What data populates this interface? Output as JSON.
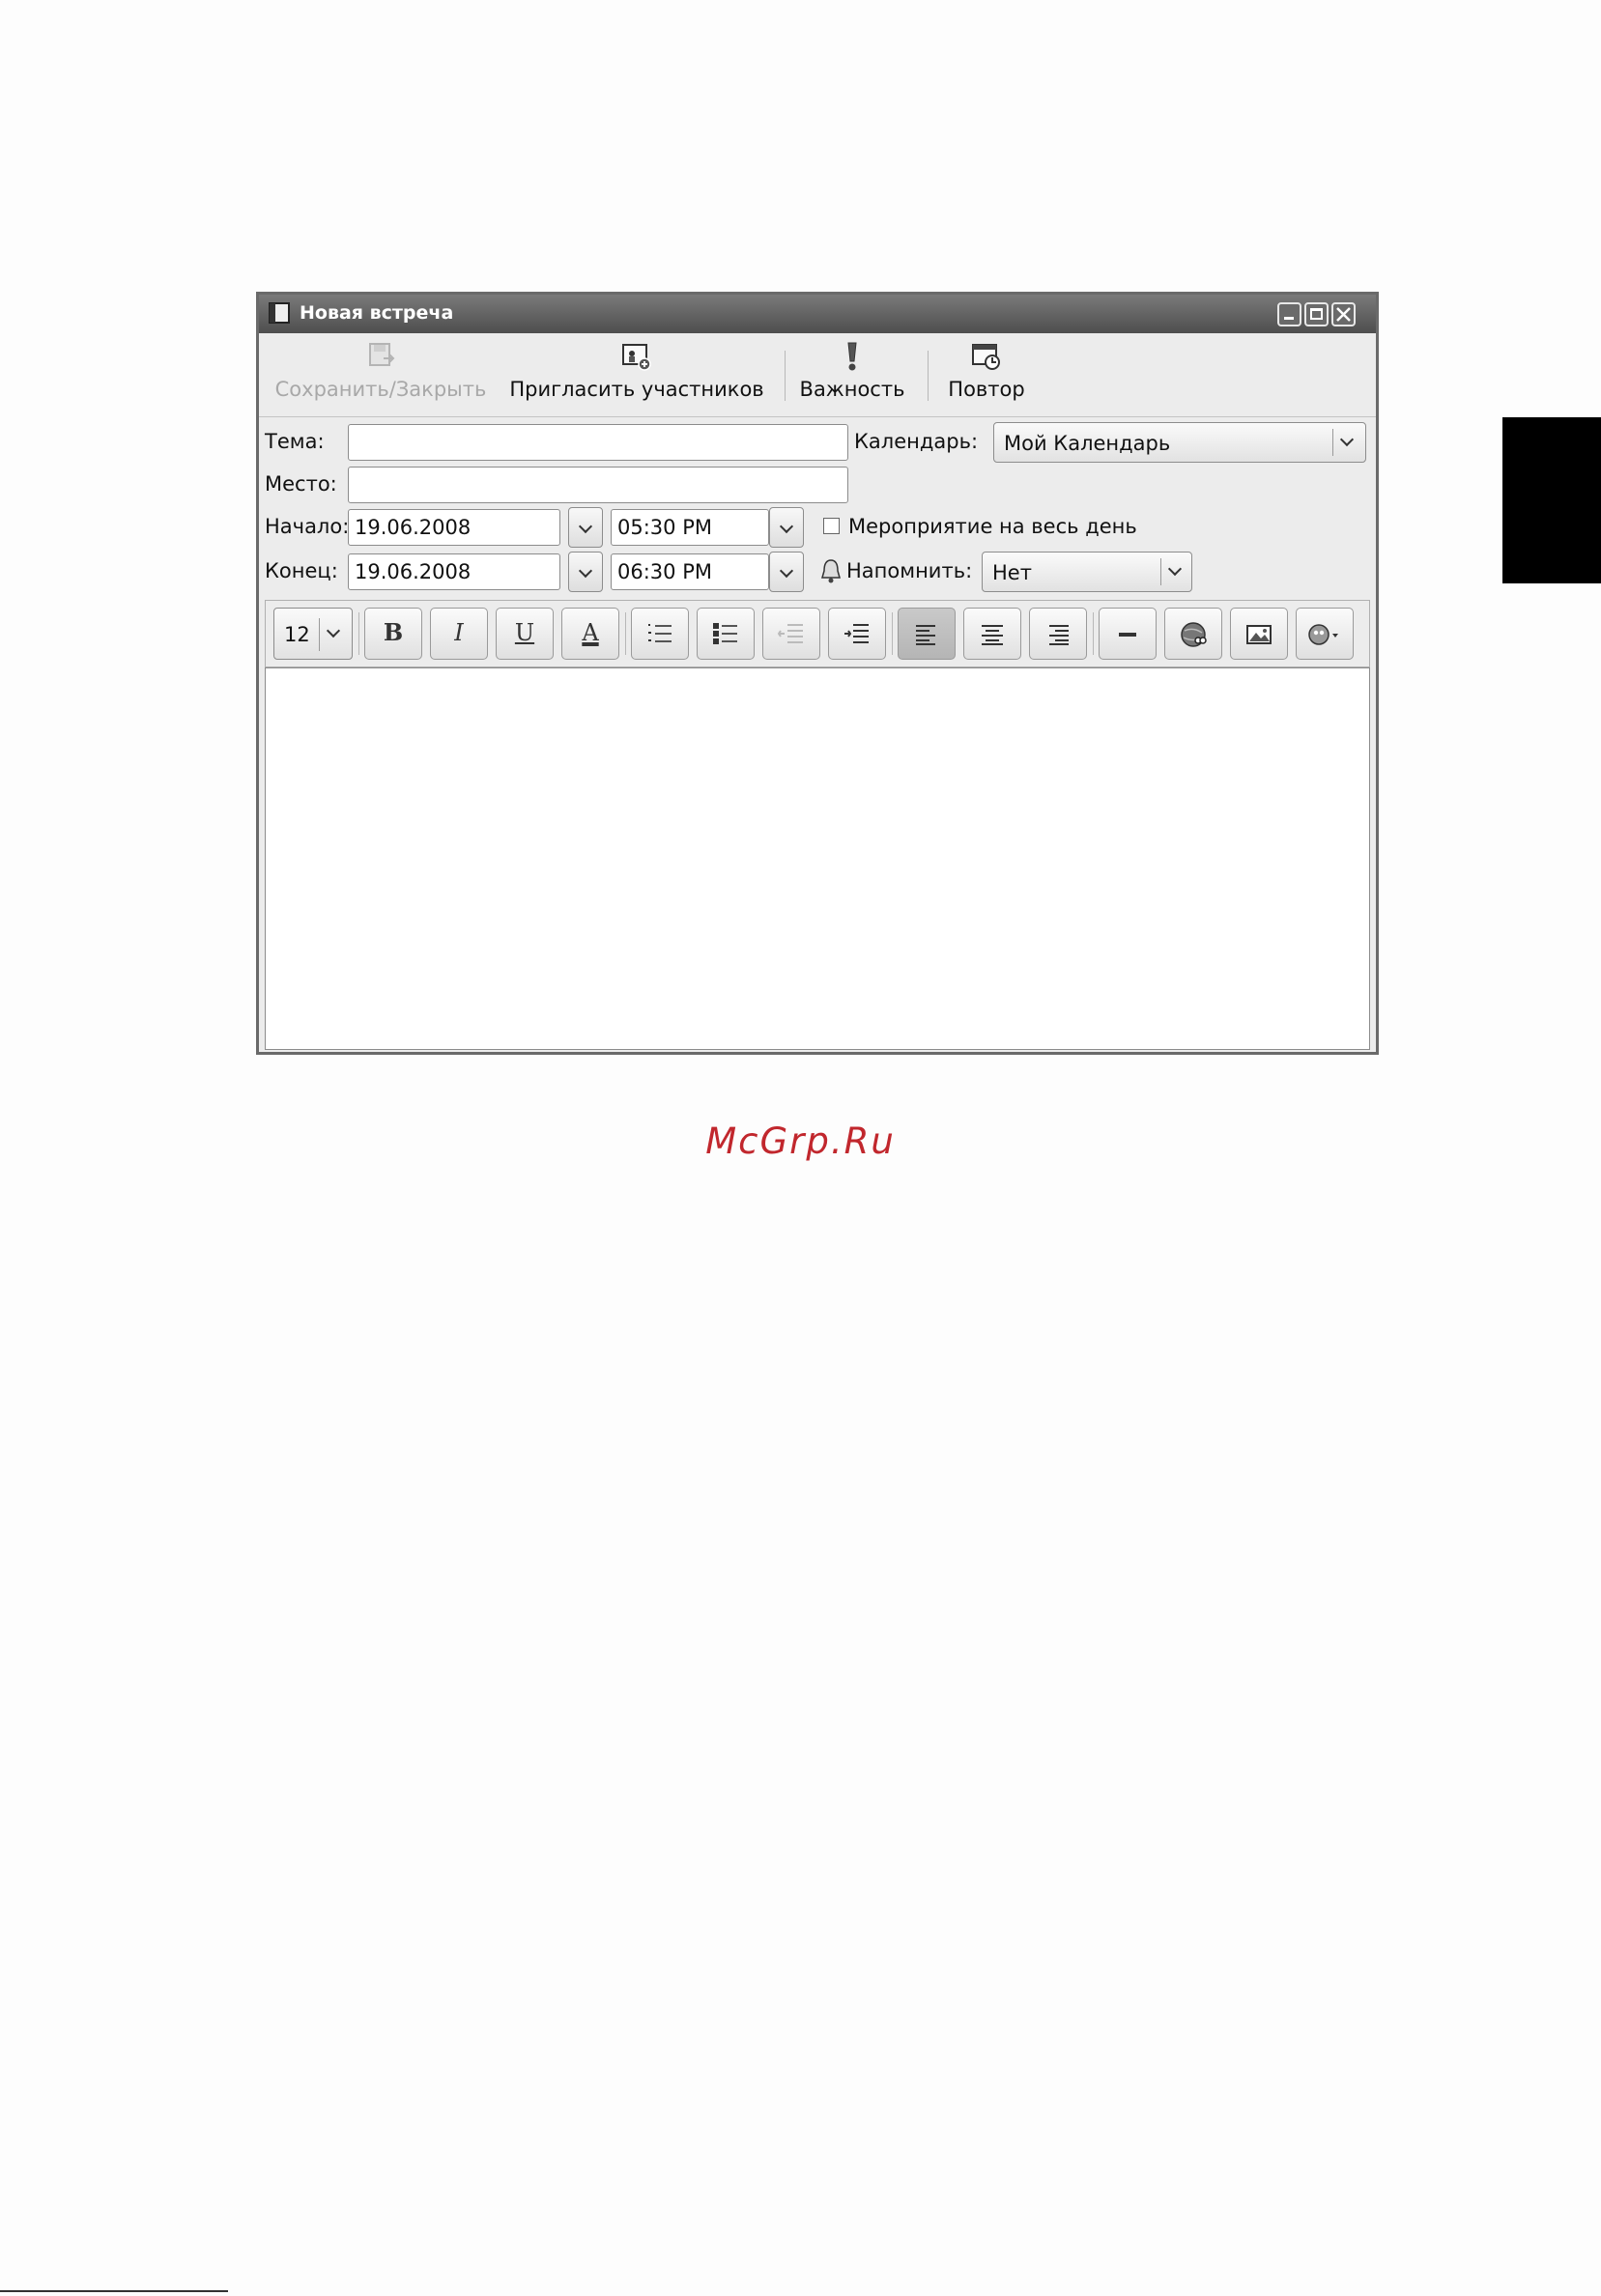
{
  "window": {
    "title": "Новая встреча"
  },
  "toolbar": {
    "save_close": "Сохранить/Закрыть",
    "invite": "Пригласить участников",
    "importance": "Важность",
    "repeat": "Повтор"
  },
  "form": {
    "subject_label": "Тема:",
    "subject_value": "",
    "location_label": "Место:",
    "location_value": "",
    "calendar_label": "Календарь:",
    "calendar_value": "Мой Календарь",
    "start_label": "Начало:",
    "start_date": "19.06.2008",
    "start_time": "05:30 PM",
    "end_label": "Конец:",
    "end_date": "19.06.2008",
    "end_time": "06:30 PM",
    "all_day_label": "Мероприятие на весь день",
    "all_day_checked": false,
    "reminder_label": "Напомнить:",
    "reminder_value": "Нет"
  },
  "format_toolbar": {
    "font_size": "12",
    "bold": "B",
    "italic": "I",
    "underline": "U",
    "font_color": "A"
  },
  "watermark": "McGrp.Ru",
  "colors": {
    "watermark": "#c1272d",
    "titlebar": "#5a5a5a"
  }
}
